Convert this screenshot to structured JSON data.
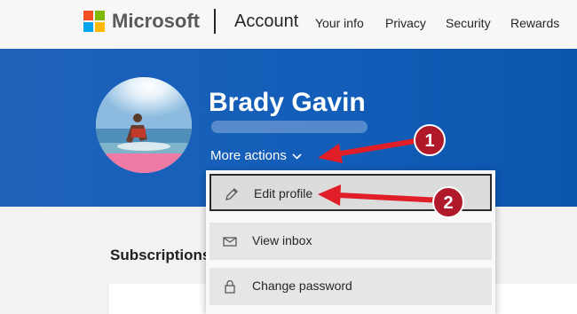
{
  "header": {
    "brand": "Microsoft",
    "section": "Account",
    "nav": [
      "Your info",
      "Privacy",
      "Security",
      "Rewards"
    ]
  },
  "profile": {
    "name": "Brady Gavin",
    "more_actions": "More actions"
  },
  "menu": {
    "items": [
      {
        "label": "Edit profile",
        "icon": "pencil-icon"
      },
      {
        "label": "View inbox",
        "icon": "mail-icon"
      },
      {
        "label": "Change password",
        "icon": "lock-icon"
      }
    ]
  },
  "section": {
    "subscriptions_title": "Subscriptions"
  },
  "callouts": [
    "1",
    "2"
  ],
  "colors": {
    "hero": "#135eb9",
    "arrow": "#e01e27",
    "badge": "#b0192a"
  }
}
